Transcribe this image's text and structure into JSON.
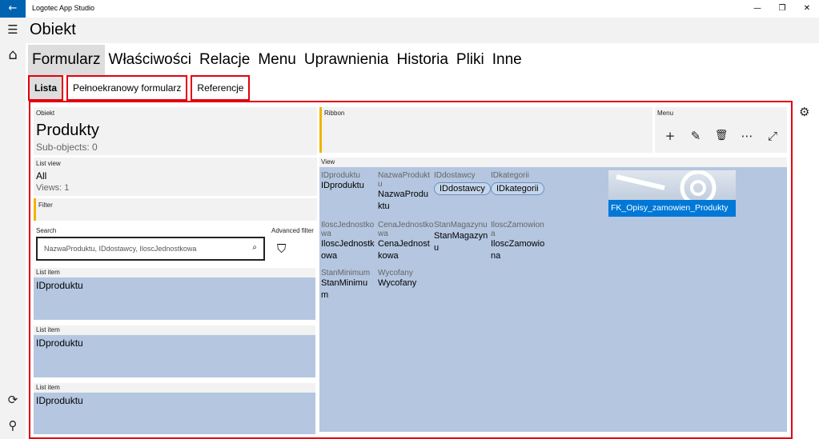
{
  "app": {
    "title": "Logotec App Studio",
    "back": "←",
    "minimize": "—",
    "restore": "❐",
    "close": "✕"
  },
  "nav": {
    "menu": "☰",
    "home": "⌂",
    "sync": "⟳",
    "plug": "⚲"
  },
  "page_title": "Obiekt",
  "main_tabs": [
    "Formularz",
    "Właściwości",
    "Relacje",
    "Menu",
    "Uprawnienia",
    "Historia",
    "Pliki",
    "Inne"
  ],
  "sub_tabs": [
    "Lista",
    "Pełnoekranowy formularz",
    "Referencje"
  ],
  "obiekt": {
    "label": "Obiekt",
    "name": "Produkty",
    "sub": "Sub-objects: 0"
  },
  "ribbon": {
    "label": "Ribbon"
  },
  "menu": {
    "label": "Menu",
    "add": "+",
    "edit": "✎",
    "delete": "🗑",
    "more": "⋯",
    "expand": "⤢"
  },
  "list_view": {
    "label": "List view",
    "value": "All",
    "views": "Views: 1"
  },
  "filter": {
    "label": "Filter"
  },
  "search": {
    "label": "Search",
    "value": "NazwaProduktu, IDdostawcy, IloscJednostkowa",
    "icon": "⌕"
  },
  "advanced_filter": {
    "label": "Advanced filter",
    "icon": "⛉"
  },
  "list_items": [
    {
      "label": "List item",
      "value": "IDproduktu"
    },
    {
      "label": "List item",
      "value": "IDproduktu"
    },
    {
      "label": "List item",
      "value": "IDproduktu"
    }
  ],
  "view": {
    "label": "View",
    "f1": {
      "l": "IDproduktu",
      "v": "IDproduktu"
    },
    "f2": {
      "l1": "NazwaProdukt",
      "l2": "u",
      "v1": "NazwaProdu",
      "v2": "ktu"
    },
    "f3": {
      "l": "IDdostawcy",
      "v": "IDdostawcy"
    },
    "f4": {
      "l": "IDkategorii",
      "v": "IDkategorii"
    },
    "f5": {
      "l1": "IloscJednostko",
      "l2": "wa",
      "v1": "IloscJednostk",
      "v2": "owa"
    },
    "f6": {
      "l1": "CenaJednostko",
      "l2": "wa",
      "v1": "CenaJednost",
      "v2": "kowa"
    },
    "f7": {
      "l": "StanMagazynu",
      "v1": "StanMagazyn",
      "v2": "u"
    },
    "f8": {
      "l1": "IloscZamowion",
      "l2": "a",
      "v1": "IloscZamowio",
      "v2": "na"
    },
    "f9": {
      "l": "StanMinimum",
      "v1": "StanMinimu",
      "v2": "m"
    },
    "f10": {
      "l": "Wycofany",
      "v": "Wycofany"
    },
    "fk": "FK_Opisy_zamowien_Produkty"
  },
  "settings_icon": "⚙"
}
